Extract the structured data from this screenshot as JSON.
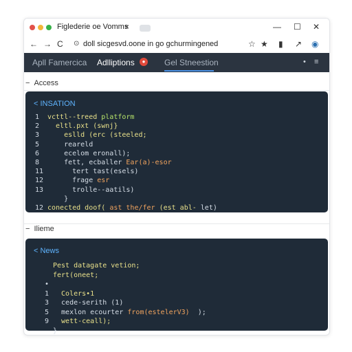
{
  "browser": {
    "tab_title": "Figlederie oe Vomms",
    "tab_close": "×",
    "url": "doll sicgesvd.oone in go gchurmingened",
    "url_icon": "lock-icon",
    "traffic_colors": [
      "#e2524a",
      "#f2b63a",
      "#38b249"
    ],
    "nav": {
      "back": "←",
      "forward": "→",
      "reload": "C"
    },
    "actions": [
      "☆",
      "★",
      "▮",
      "↗",
      "◉"
    ],
    "window_controls": [
      "—",
      "☐",
      "✕"
    ]
  },
  "app": {
    "tabs": [
      {
        "label": "Apll Famercica",
        "active": false
      },
      {
        "label": "Adlliptions",
        "active": true
      },
      {
        "label": "Gel Stneestion",
        "active": false
      }
    ],
    "badge_count": "●",
    "header_icons": [
      "•",
      "≡"
    ],
    "accent": "#4a90e2"
  },
  "sections": [
    {
      "label": "Access",
      "toggle": "−",
      "panel_title": "< INSATION",
      "lines": [
        {
          "num": "1",
          "text": "vcttl--treed",
          "text2": "platform",
          "color": "#e8e08a",
          "color2": "#b6e36a"
        },
        {
          "num": "2",
          "text": "  eltl.pxt (swnj}",
          "color": "#e8e08a"
        },
        {
          "num": "3",
          "text": "    eslld (erc (steeled;",
          "color": "#e8e08a"
        },
        {
          "num": "5",
          "text": "    reareld",
          "color": "#d6dee7"
        },
        {
          "num": "6",
          "text": "    ecelom eronall);",
          "color": "#d6dee7"
        },
        {
          "num": "8",
          "text": "    fett, ecballer",
          "text2": "Ear(a)-esor",
          "color": "#d6dee7",
          "color2": "#f0a35e"
        },
        {
          "num": "11",
          "text": "      tert tast(esels)",
          "color": "#d6dee7"
        },
        {
          "num": "12",
          "text": "      frage",
          "text2": "esr",
          "color": "#d6dee7",
          "color2": "#f0a35e"
        },
        {
          "num": "13",
          "text": "      trolle--aatils)",
          "color": "#d6dee7"
        },
        {
          "num": "",
          "text": "    }",
          "color": "#d6dee7"
        },
        {
          "num": "12",
          "text": "conected doof(",
          "text2": "ast the/fer",
          "text3": "(est abl-",
          "text4": "let)",
          "color": "#e8e08a",
          "color2": "#f0a35e",
          "color3": "#e8e08a",
          "color4": "#d6dee7"
        }
      ]
    },
    {
      "label": "Ilieme",
      "toggle": "−",
      "panel_title": "< News",
      "lines": [
        {
          "num": "",
          "text": "Pest datagate vetion;",
          "color": "#e8e08a"
        },
        {
          "num": "",
          "text": "fert(oneet;",
          "color": "#e8e08a"
        },
        {
          "num": "•",
          "text": "",
          "color": "#d6dee7"
        },
        {
          "num": "1",
          "text": "  Colers•1",
          "color": "#e8e08a"
        },
        {
          "num": "3",
          "text": "  cede-serith (1)",
          "color": "#d6dee7"
        },
        {
          "num": "5",
          "text": "  mexlon ecourter",
          "text2": "from(estelerV3)",
          "text3": " );",
          "color": "#d6dee7",
          "color2": "#f0a35e",
          "color3": "#d6dee7"
        },
        {
          "num": "9",
          "text": "  wett-ceall);",
          "color": "#e8e08a"
        },
        {
          "num": "",
          "text": "}",
          "color": "#d6dee7"
        }
      ]
    }
  ]
}
